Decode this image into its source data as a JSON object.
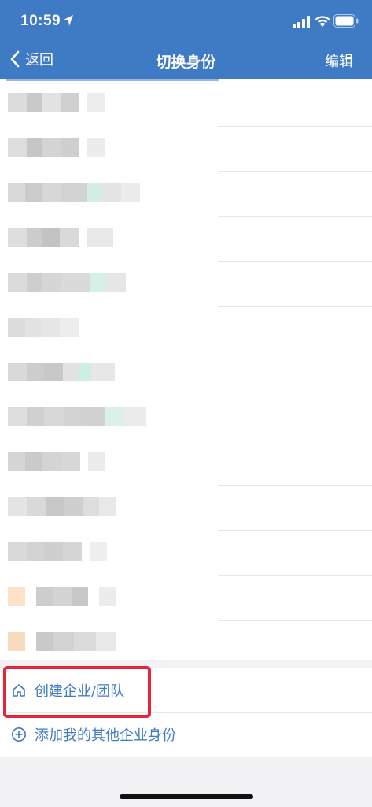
{
  "status_bar": {
    "time": "10:59",
    "icons": [
      "location-arrow-icon",
      "cellular-signal-icon",
      "wifi-icon",
      "battery-icon"
    ]
  },
  "nav": {
    "back_label": "返回",
    "title": "切换身份",
    "edit_label": "编辑"
  },
  "identities_count": 13,
  "actions": {
    "create_label": "创建企业/团队",
    "add_label": "添加我的其他企业身份"
  },
  "colors": {
    "brand": "#3f7ac4",
    "highlight_box": "#e8243a"
  }
}
